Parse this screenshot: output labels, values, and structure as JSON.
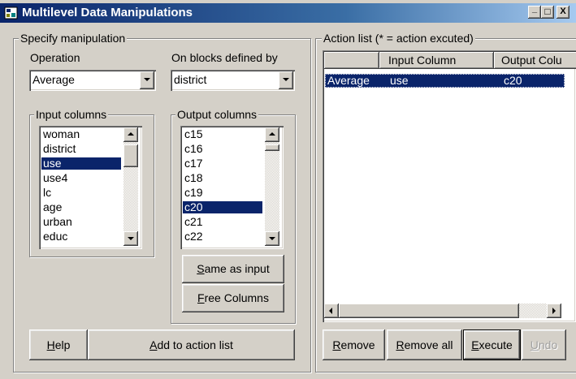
{
  "window": {
    "title": "Multilevel Data Manipulations",
    "minimize": "_",
    "maximize": "□",
    "close": "X"
  },
  "specify": {
    "group_label": "Specify manipulation",
    "operation_label": "Operation",
    "operation_value": "Average",
    "blocks_label": "On blocks defined by",
    "blocks_value": "district",
    "input_columns_label": "Input columns",
    "input_columns": [
      {
        "label": "woman",
        "selected": false
      },
      {
        "label": "district",
        "selected": false
      },
      {
        "label": "use",
        "selected": true
      },
      {
        "label": "use4",
        "selected": false
      },
      {
        "label": "lc",
        "selected": false
      },
      {
        "label": "age",
        "selected": false
      },
      {
        "label": "urban",
        "selected": false
      },
      {
        "label": "educ",
        "selected": false
      }
    ],
    "output_columns_label": "Output columns",
    "output_columns": [
      {
        "label": "c15",
        "selected": false
      },
      {
        "label": "c16",
        "selected": false
      },
      {
        "label": "c17",
        "selected": false
      },
      {
        "label": "c18",
        "selected": false
      },
      {
        "label": "c19",
        "selected": false
      },
      {
        "label": "c20",
        "selected": true
      },
      {
        "label": "c21",
        "selected": false
      },
      {
        "label": "c22",
        "selected": false
      }
    ],
    "same_as_input_key": "S",
    "same_as_input_rest": "ame as input",
    "free_columns_key": "F",
    "free_columns_rest": "ree Columns",
    "help_key": "H",
    "help_rest": "elp",
    "add_key": "A",
    "add_rest": "dd to action list"
  },
  "action_list": {
    "group_label": "Action list (* = action excuted)",
    "columns": [
      "",
      "Input Column",
      "Output Colu"
    ],
    "rows": [
      {
        "operation": "Average",
        "input": "use",
        "output": "c20",
        "selected": true
      }
    ],
    "remove_key": "R",
    "remove_rest": "emove",
    "remove_all_pre": "",
    "remove_all_key": "R",
    "remove_all_rest": "emove all",
    "execute_pre": "",
    "execute_key": "E",
    "execute_rest": "xecute",
    "undo_key": "U",
    "undo_rest": "ndo"
  },
  "colors": {
    "face": "#d4d0c8",
    "selection": "#0a246a",
    "title_start": "#0a246a",
    "title_end": "#a6caf0"
  }
}
